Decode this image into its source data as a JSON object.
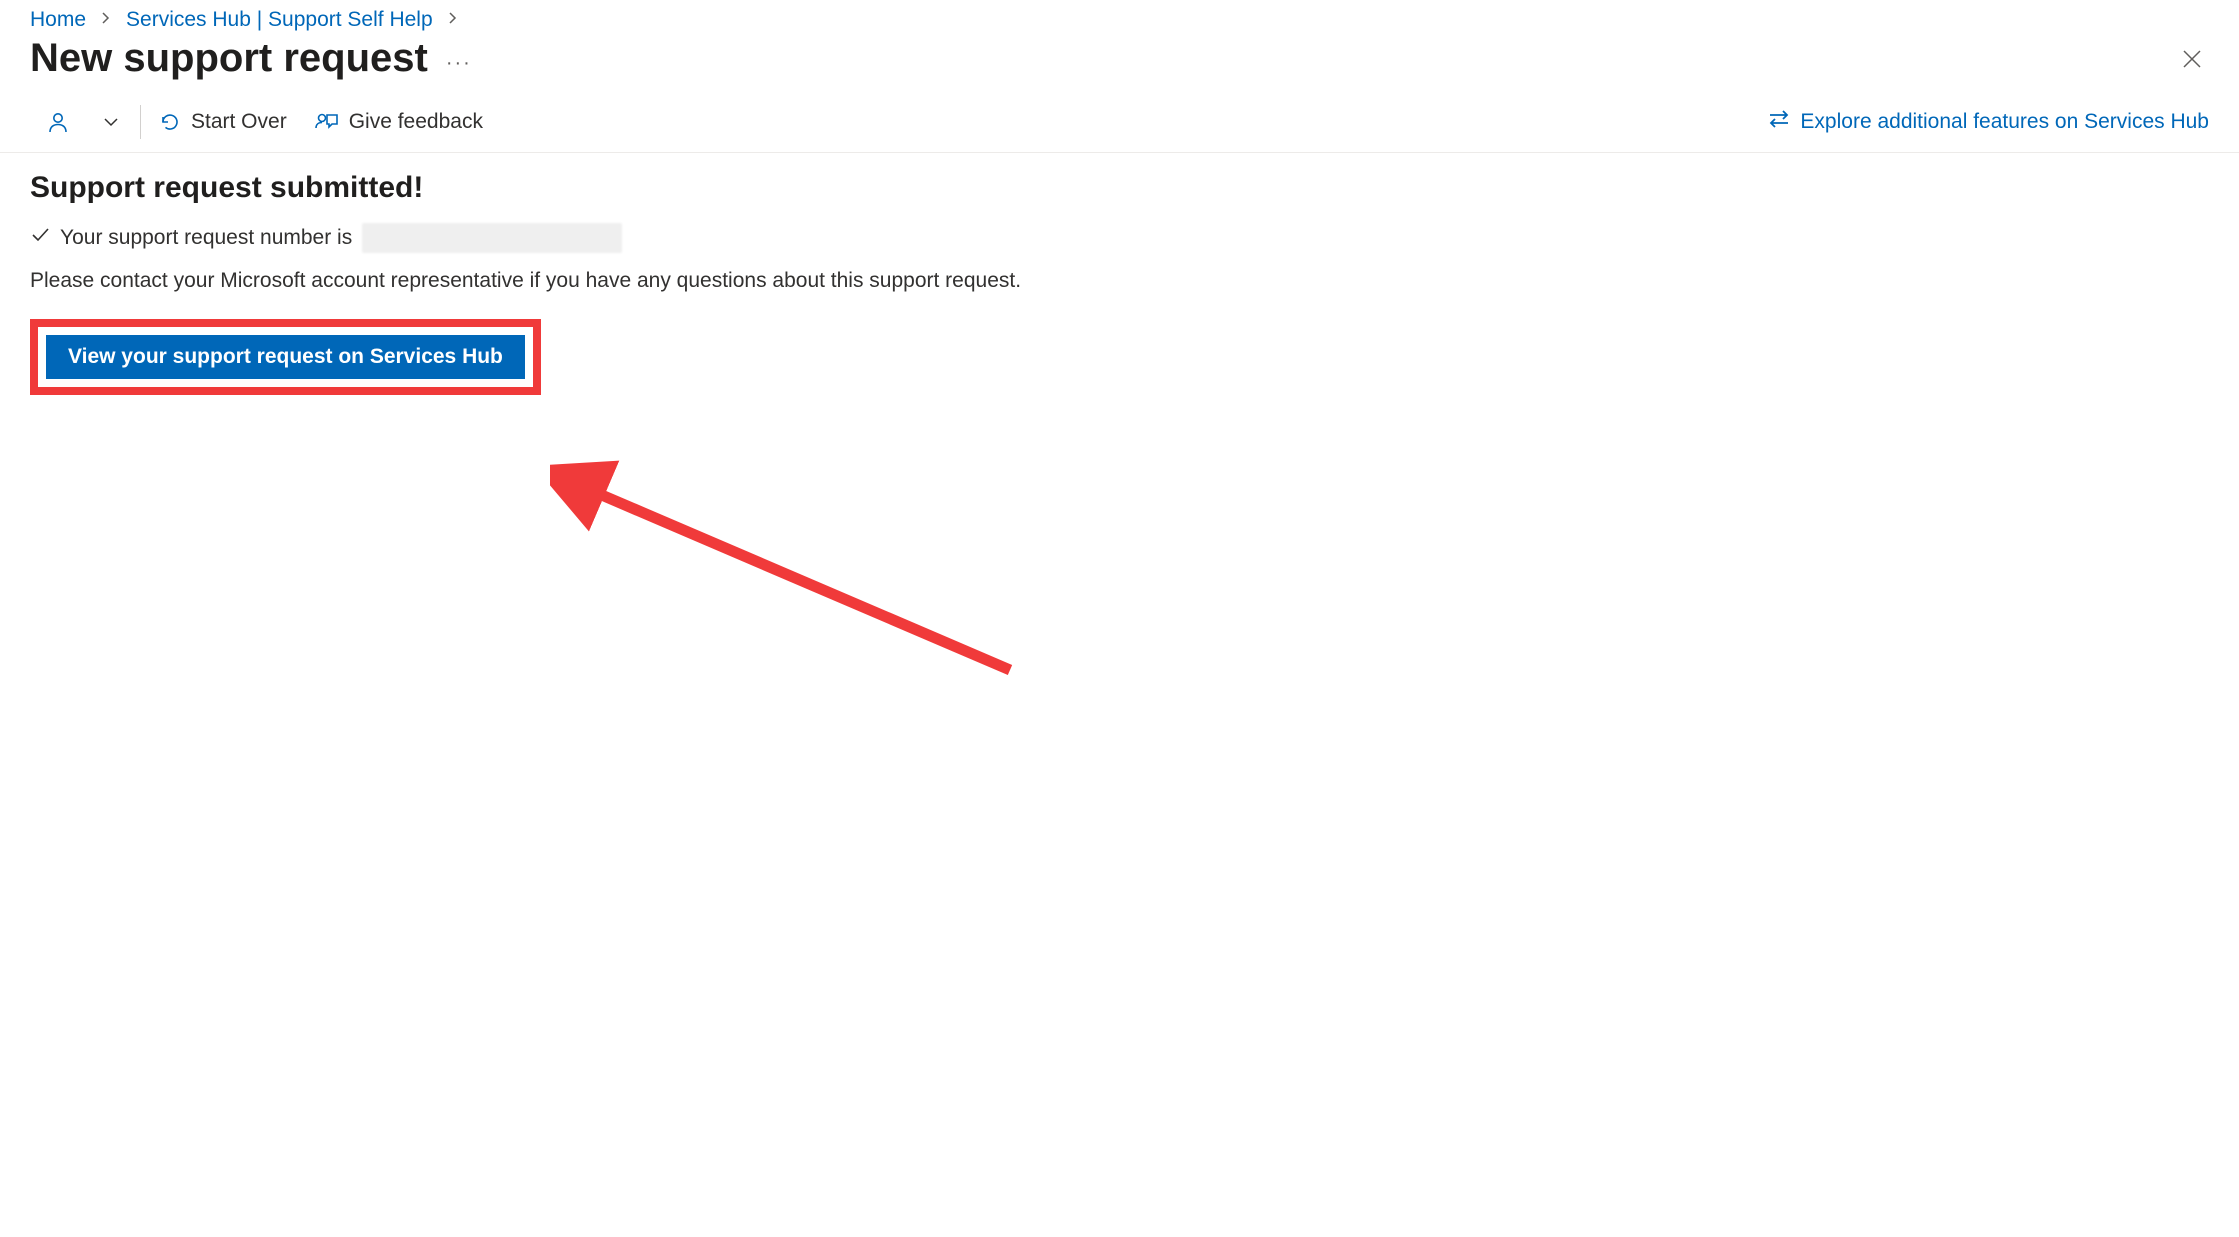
{
  "breadcrumb": {
    "items": [
      {
        "label": "Home"
      },
      {
        "label": "Services Hub | Support Self Help"
      }
    ]
  },
  "page_title": "New support request",
  "command_bar": {
    "start_over": "Start Over",
    "give_feedback": "Give feedback",
    "explore": "Explore additional features on Services Hub"
  },
  "content": {
    "heading": "Support request submitted!",
    "confirm_prefix": "Your support request number is",
    "help_text": "Please contact your Microsoft account representative if you have any questions about this support request.",
    "view_button": "View your support request on Services Hub"
  },
  "colors": {
    "link": "#0067b8",
    "annotation": "#f03a3a"
  }
}
